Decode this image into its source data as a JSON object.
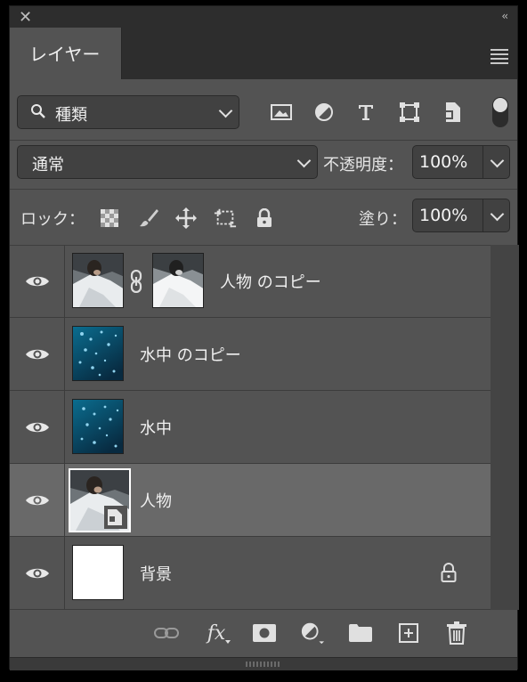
{
  "panel": {
    "close_icon": "close-icon",
    "collapse_icon": "double-chevron-icon",
    "tab_label": "レイヤー",
    "menu_icon": "hamburger-menu-icon"
  },
  "filter": {
    "kind_label": "種類",
    "icons": [
      "image-filter-icon",
      "adjustment-filter-icon",
      "type-filter-icon",
      "shape-filter-icon",
      "smart-object-filter-icon"
    ],
    "toggle_on": true
  },
  "blend": {
    "mode": "通常",
    "opacity_label": "不透明度：",
    "opacity_value": "100%"
  },
  "lock": {
    "label": "ロック：",
    "icons": [
      "lock-transparent-pixels-icon",
      "lock-image-pixels-icon",
      "lock-position-icon",
      "lock-artboard-icon",
      "lock-all-icon"
    ],
    "fill_label": "塗り：",
    "fill_value": "100%"
  },
  "layers": [
    {
      "name": "人物 のコピー",
      "visible": true,
      "thumb": "person",
      "has_mask": true,
      "selected": false,
      "locked": false
    },
    {
      "name": "水中 のコピー",
      "visible": true,
      "thumb": "water",
      "has_mask": false,
      "selected": false,
      "locked": false
    },
    {
      "name": "水中",
      "visible": true,
      "thumb": "water",
      "has_mask": false,
      "selected": false,
      "locked": false
    },
    {
      "name": "人物",
      "visible": true,
      "thumb": "person",
      "has_mask": false,
      "selected": true,
      "smart_object": true,
      "locked": false
    },
    {
      "name": "背景",
      "visible": true,
      "thumb": "white",
      "has_mask": false,
      "selected": false,
      "locked": true
    }
  ],
  "footer": {
    "icons": [
      "link-layers-icon",
      "fx-icon",
      "add-mask-icon",
      "new-adjustment-icon",
      "new-group-icon",
      "new-layer-icon",
      "trash-icon"
    ],
    "fx_label": "fx"
  },
  "colors": {
    "panel_bg": "#535353",
    "selected_row": "#696969",
    "header_bg": "#2d2d2d"
  }
}
